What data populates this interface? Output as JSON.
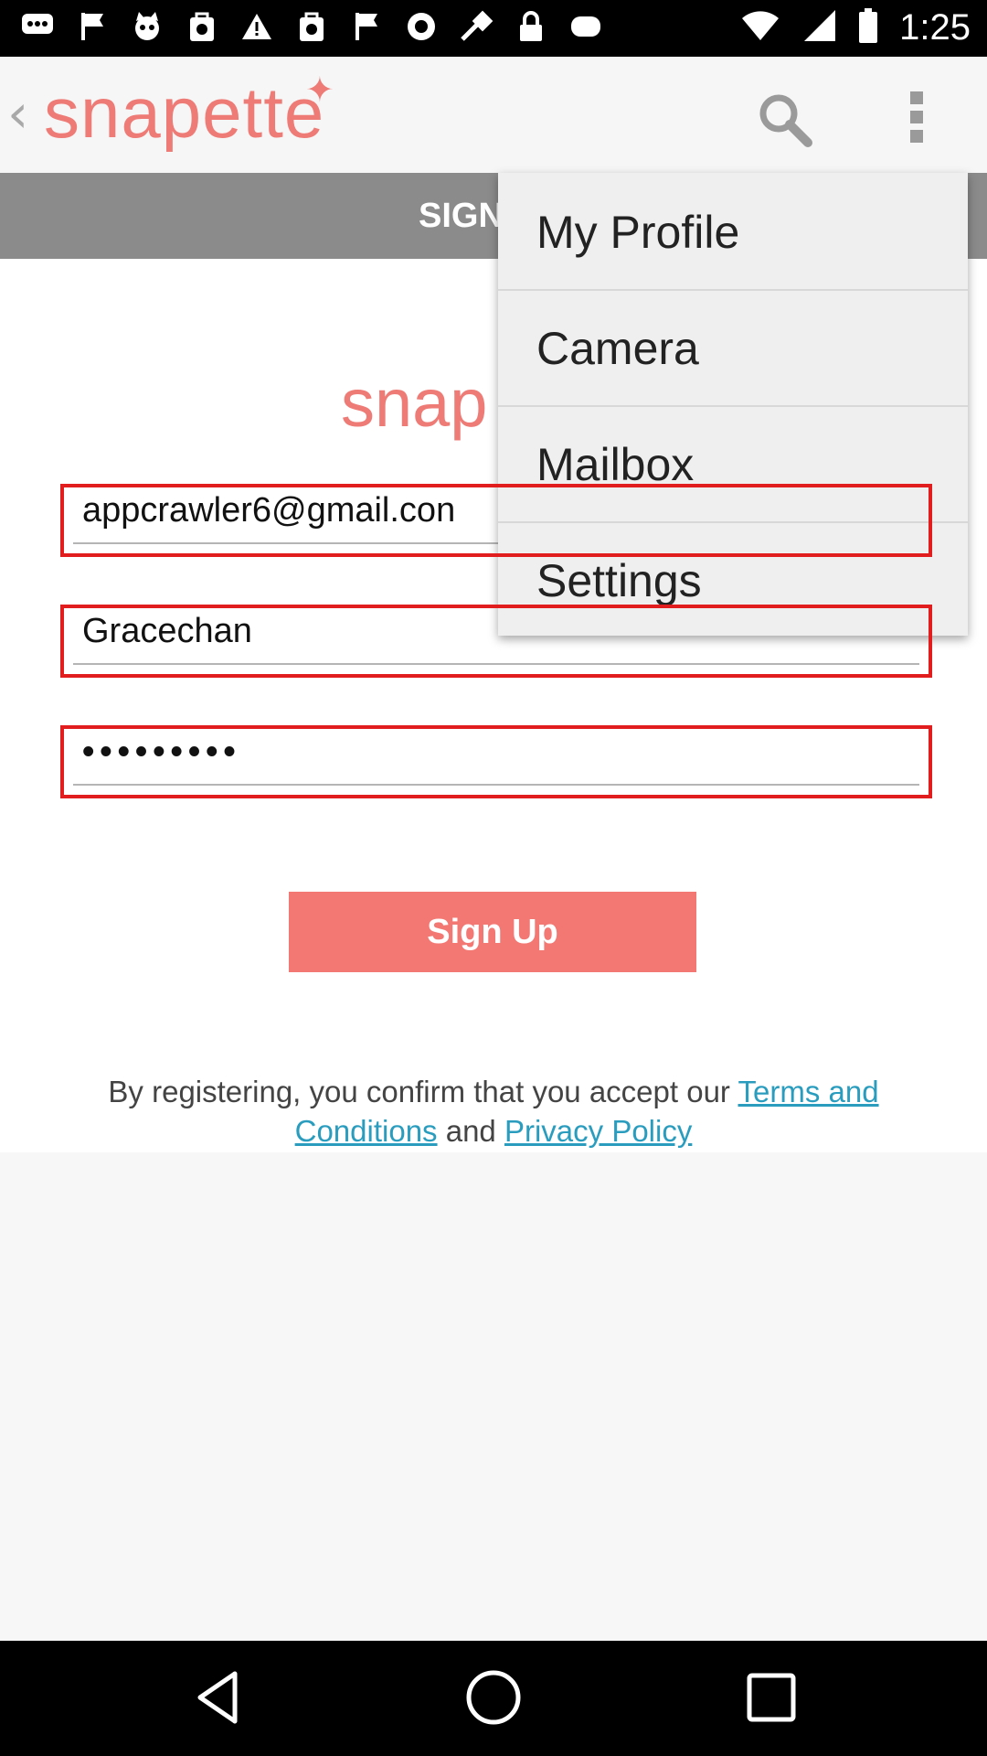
{
  "status_bar": {
    "time": "1:25",
    "icons": [
      "chat-bubble-icon",
      "flag-icon",
      "cat-icon",
      "cat-bag-icon",
      "warning-icon",
      "cat-bag-icon",
      "flag-icon",
      "info-icon",
      "fake-gps-icon",
      "lock-icon",
      "cloud-icon"
    ]
  },
  "app_bar": {
    "logo": "snapette",
    "search_icon": "search-icon",
    "overflow_icon": "more-vert-icon"
  },
  "tab_strip": {
    "label": "SIGN"
  },
  "content": {
    "logo": "snap",
    "email": "appcrawler6@gmail.con",
    "username": "Gracechan",
    "password": "•••••••••",
    "signup_label": "Sign Up",
    "legal_prefix": "By registering, you confirm that you accept our ",
    "terms_link": "Terms and Conditions",
    "legal_mid": " and ",
    "privacy_link": "Privacy Policy"
  },
  "menu": {
    "items": [
      {
        "label": "My Profile"
      },
      {
        "label": "Camera"
      },
      {
        "label": "Mailbox"
      },
      {
        "label": "Settings"
      }
    ]
  },
  "colors": {
    "brand": "#ee7b76",
    "button": "#f37873",
    "highlight_border": "#e21d1d",
    "link": "#2a9dbf",
    "tab_strip": "#8b8b8b"
  }
}
